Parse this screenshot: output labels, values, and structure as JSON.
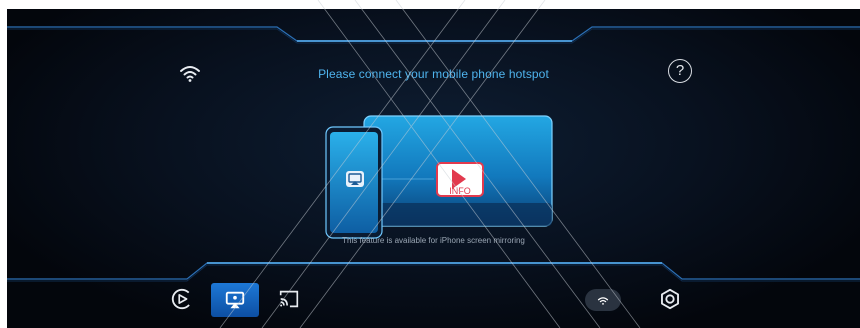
{
  "header": {
    "title": "Please connect your mobile phone hotspot"
  },
  "illustration": {
    "badge_text": "INFO"
  },
  "caption": "This feature is available for iPhone screen mirroring",
  "help": {
    "glyph": "?"
  },
  "nav": {
    "items": [
      {
        "icon": "carplay-icon",
        "active": false
      },
      {
        "icon": "airplay-icon",
        "active": true
      },
      {
        "icon": "cast-icon",
        "active": false
      },
      {
        "icon": "wifi-icon",
        "active": false
      },
      {
        "icon": "settings-icon",
        "active": false
      }
    ]
  },
  "colors": {
    "accent": "#4fb4ee",
    "active_nav": "#1d78d6",
    "badge": "#e23a4e"
  }
}
